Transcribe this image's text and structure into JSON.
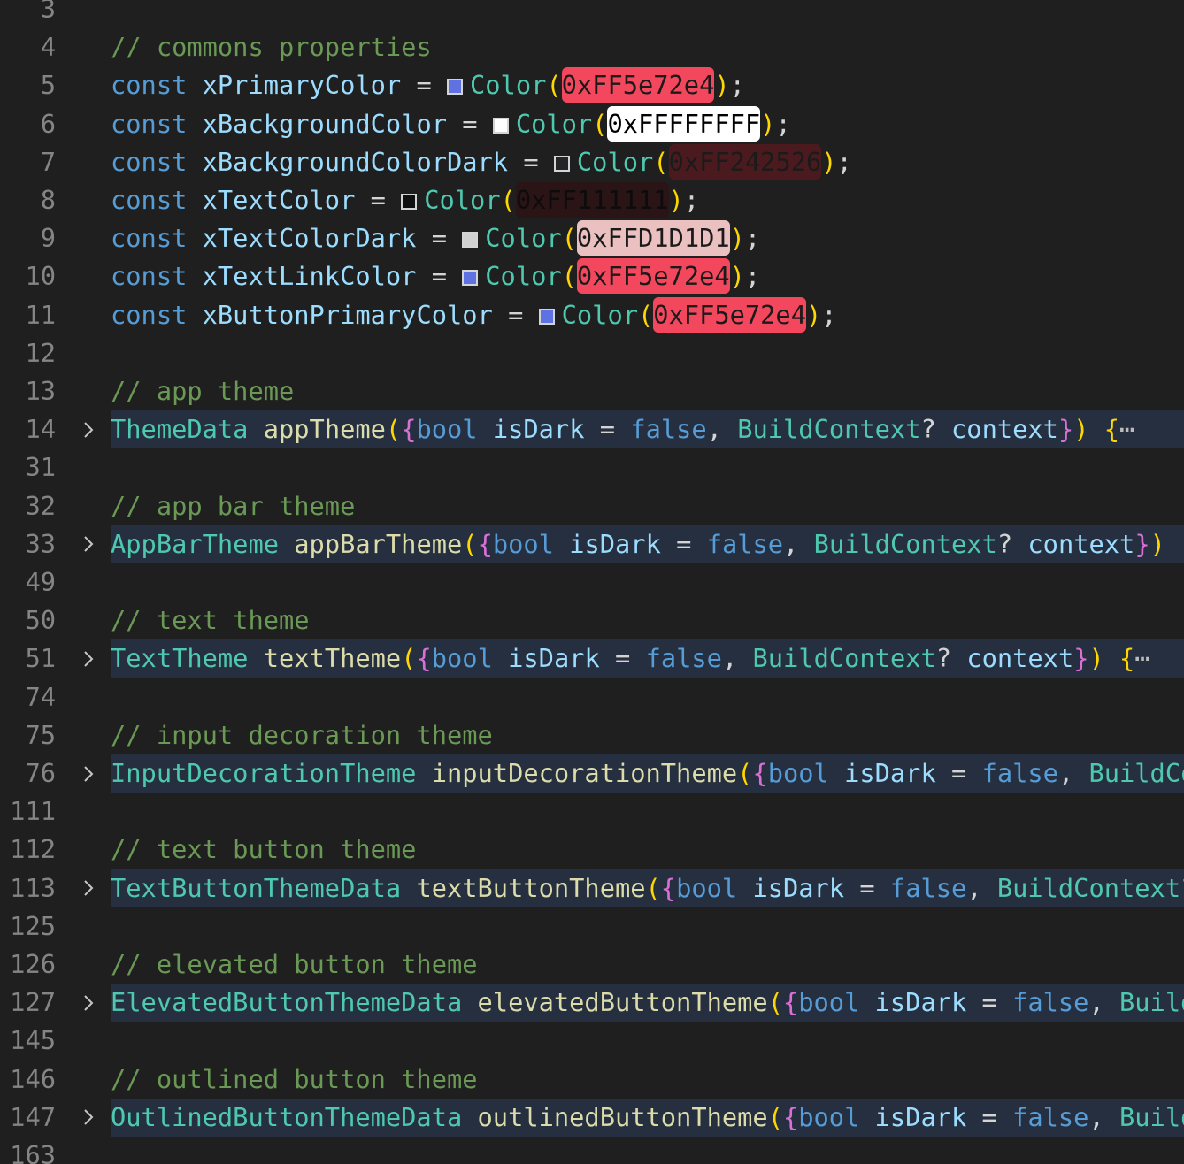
{
  "editor": {
    "lines": [
      {
        "num": "3",
        "kind": "blank"
      },
      {
        "num": "4",
        "kind": "comment",
        "text": "// commons properties"
      },
      {
        "num": "5",
        "kind": "const",
        "name": "xPrimaryColor",
        "ctor": "Color",
        "hex": "0xFF5e72e4",
        "swatch": "#5e72e4",
        "hl": "hl-blue"
      },
      {
        "num": "6",
        "kind": "const",
        "name": "xBackgroundColor",
        "ctor": "Color",
        "hex": "0xFFFFFFFF",
        "swatch": "#ffffff",
        "hl": "hl-white"
      },
      {
        "num": "7",
        "kind": "const",
        "name": "xBackgroundColorDark",
        "ctor": "Color",
        "hex": "0xFF242526",
        "swatch": "#242526",
        "hl": "hl-dark1"
      },
      {
        "num": "8",
        "kind": "const",
        "name": "xTextColor",
        "ctor": "Color",
        "hex": "0xFF111111",
        "swatch": "#111111",
        "hl": "hl-dark2"
      },
      {
        "num": "9",
        "kind": "const",
        "name": "xTextColorDark",
        "ctor": "Color",
        "hex": "0xFFD1D1D1",
        "swatch": "#d1d1d1",
        "hl": "hl-grey"
      },
      {
        "num": "10",
        "kind": "const",
        "name": "xTextLinkColor",
        "ctor": "Color",
        "hex": "0xFF5e72e4",
        "swatch": "#5e72e4",
        "hl": "hl-blue"
      },
      {
        "num": "11",
        "kind": "const",
        "name": "xButtonPrimaryColor",
        "ctor": "Color",
        "hex": "0xFF5e72e4",
        "swatch": "#5e72e4",
        "hl": "hl-blue"
      },
      {
        "num": "12",
        "kind": "blank"
      },
      {
        "num": "13",
        "kind": "comment",
        "text": "// app theme"
      },
      {
        "num": "14",
        "kind": "fn",
        "type": "ThemeData",
        "fn": "appTheme",
        "tail": ") {",
        "ellipsis": "⋯"
      },
      {
        "num": "31",
        "kind": "blank"
      },
      {
        "num": "32",
        "kind": "comment",
        "text": "// app bar theme"
      },
      {
        "num": "33",
        "kind": "fn",
        "type": "AppBarTheme",
        "fn": "appBarTheme",
        "tail": ")",
        "ellipsis": ""
      },
      {
        "num": "49",
        "kind": "blank"
      },
      {
        "num": "50",
        "kind": "comment",
        "text": "// text theme"
      },
      {
        "num": "51",
        "kind": "fn",
        "type": "TextTheme",
        "fn": "textTheme",
        "tail": ") {",
        "ellipsis": "⋯"
      },
      {
        "num": "74",
        "kind": "blank"
      },
      {
        "num": "75",
        "kind": "comment",
        "text": "// input decoration theme"
      },
      {
        "num": "76",
        "kind": "fn",
        "type": "InputDecorationTheme",
        "fn": "inputDecorationTheme",
        "tail": "",
        "ellipsis": ""
      },
      {
        "num": "111",
        "kind": "blank"
      },
      {
        "num": "112",
        "kind": "comment",
        "text": "// text button theme"
      },
      {
        "num": "113",
        "kind": "fn",
        "type": "TextButtonThemeData",
        "fn": "textButtonTheme",
        "tail": "",
        "ellipsis": ""
      },
      {
        "num": "125",
        "kind": "blank"
      },
      {
        "num": "126",
        "kind": "comment",
        "text": "// elevated button theme"
      },
      {
        "num": "127",
        "kind": "fn",
        "type": "ElevatedButtonThemeData",
        "fn": "elevatedButtonTheme",
        "tail": "",
        "ellipsis": ""
      },
      {
        "num": "145",
        "kind": "blank"
      },
      {
        "num": "146",
        "kind": "comment",
        "text": "// outlined button theme"
      },
      {
        "num": "147",
        "kind": "fn",
        "type": "OutlinedButtonThemeData",
        "fn": "outlinedButtonTheme",
        "tail": "",
        "ellipsis": ""
      },
      {
        "num": "163",
        "kind": "blank"
      }
    ],
    "tokens": {
      "const_kw": "const",
      "assign": " = ",
      "semicolon": ";",
      "param_bool": "bool",
      "param_isDark": "isDark",
      "param_false": "false",
      "param_ctx_type": "BuildContext",
      "param_ctx_name": "context"
    },
    "fold_icon": "chevron-right-icon",
    "colors": {
      "background": "#1f1f1f",
      "folded_line": "#262f3f",
      "line_number": "#858585"
    }
  }
}
